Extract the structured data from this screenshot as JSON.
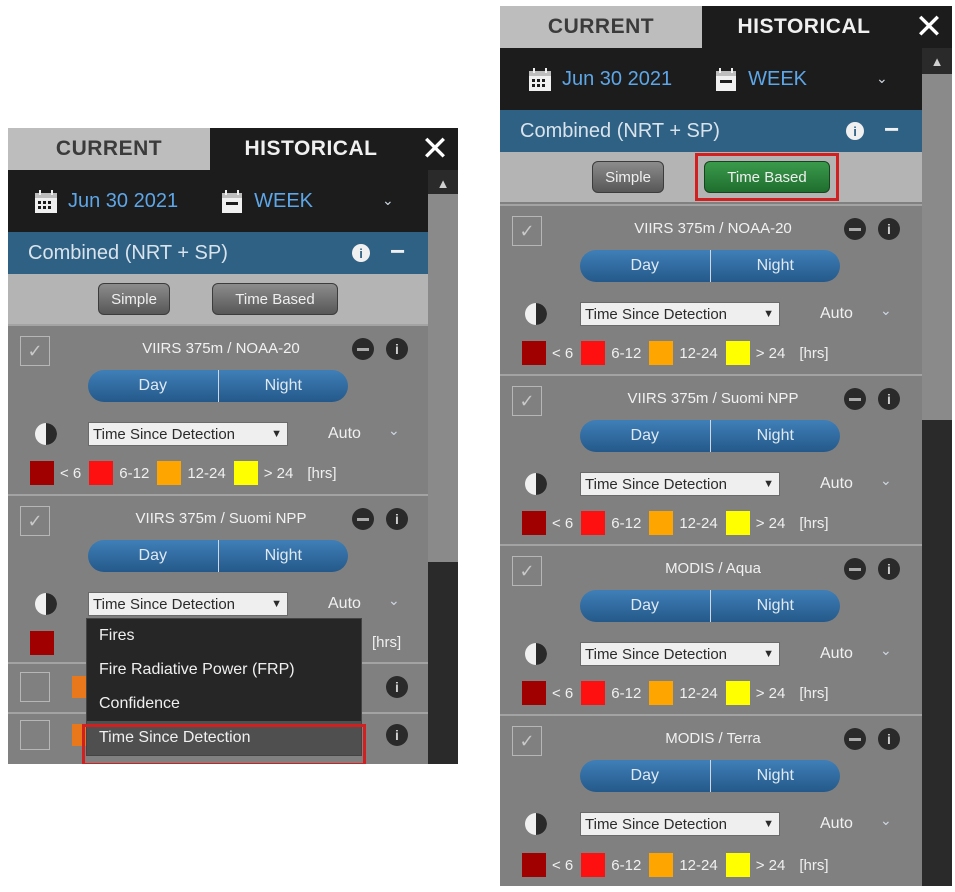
{
  "tabs": {
    "current": "CURRENT",
    "historical": "HISTORICAL",
    "close": "✕"
  },
  "date": {
    "value": "Jun 30 2021",
    "period": "WEEK"
  },
  "source": {
    "title": "Combined (NRT + SP)",
    "info": "i",
    "collapse": "−"
  },
  "modes": {
    "simple": "Simple",
    "time_based": "Time Based"
  },
  "controls": {
    "day": "Day",
    "night": "Night",
    "color_by": "Time Since Detection",
    "auto": "Auto"
  },
  "legend": {
    "items": [
      {
        "label": "< 6",
        "color": "#a00000"
      },
      {
        "label": "6-12",
        "color": "#ff1010"
      },
      {
        "label": "12-24",
        "color": "#ffa500"
      },
      {
        "label": "> 24",
        "color": "#ffff00"
      }
    ],
    "unit": "[hrs]"
  },
  "layersA": [
    {
      "name": "VIIRS 375m / NOAA-20"
    },
    {
      "name": "VIIRS 375m / Suomi NPP"
    }
  ],
  "layersB": [
    {
      "name": "VIIRS 375m / NOAA-20"
    },
    {
      "name": "VIIRS 375m / Suomi NPP"
    },
    {
      "name": "MODIS / Aqua"
    },
    {
      "name": "MODIS / Terra"
    }
  ],
  "dropdown": {
    "options": [
      "Fires",
      "Fire Radiative Power (FRP)",
      "Confidence",
      "Time Since Detection"
    ],
    "selected": "Time Since Detection"
  },
  "colors": {
    "panel_bg": "#808080",
    "dark_bar": "#1c1c1c",
    "header_blue": "#2f6184",
    "accent_blue": "#5da6e8",
    "active_green": "#2e8a3f",
    "highlight_red": "#d21f1f"
  },
  "icons": [
    "calendar-icon",
    "list-calendar-icon",
    "chevron-down-icon",
    "info-icon",
    "minus-icon",
    "close-icon",
    "checkmark-icon",
    "contrast-icon",
    "caret-up-icon"
  ]
}
